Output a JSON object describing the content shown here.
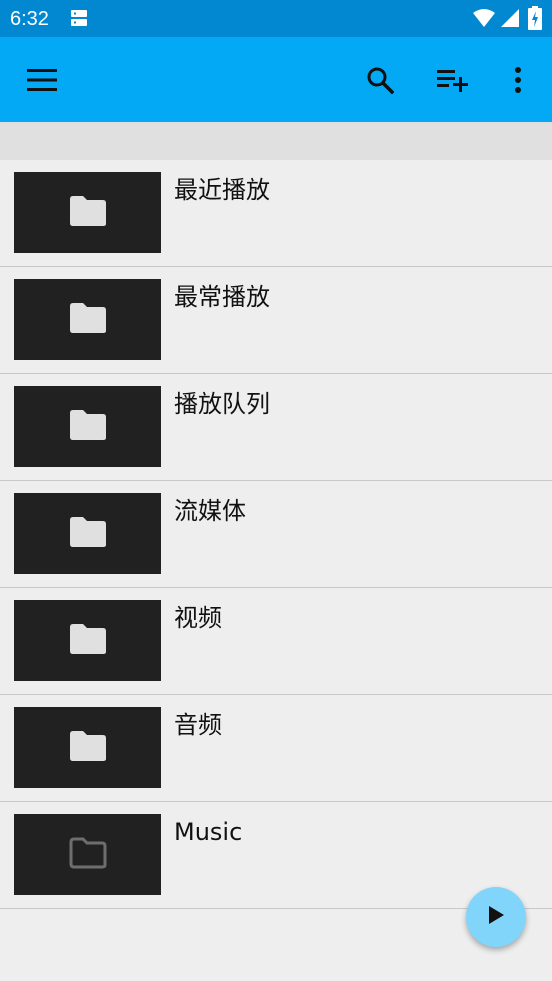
{
  "status_bar": {
    "time": "6:32",
    "icons": [
      "sd-storage-icon",
      "wifi-icon",
      "signal-icon",
      "battery-charging-icon"
    ],
    "background": "#0288d1"
  },
  "app_bar": {
    "background": "#03a9f4",
    "icons": [
      "menu-icon",
      "search-icon",
      "playlist-add-icon",
      "more-vert-icon"
    ]
  },
  "browse_list": {
    "items": [
      {
        "label": "最近播放",
        "icon": "folder-icon"
      },
      {
        "label": "最常播放",
        "icon": "folder-icon"
      },
      {
        "label": "播放队列",
        "icon": "folder-icon"
      },
      {
        "label": "流媒体",
        "icon": "folder-icon"
      },
      {
        "label": "视频",
        "icon": "folder-icon"
      },
      {
        "label": "音频",
        "icon": "folder-icon"
      },
      {
        "label": "Music",
        "icon": "folder-outline-icon"
      }
    ]
  },
  "fab": {
    "icon": "play-icon",
    "background": "#81d4fa"
  }
}
